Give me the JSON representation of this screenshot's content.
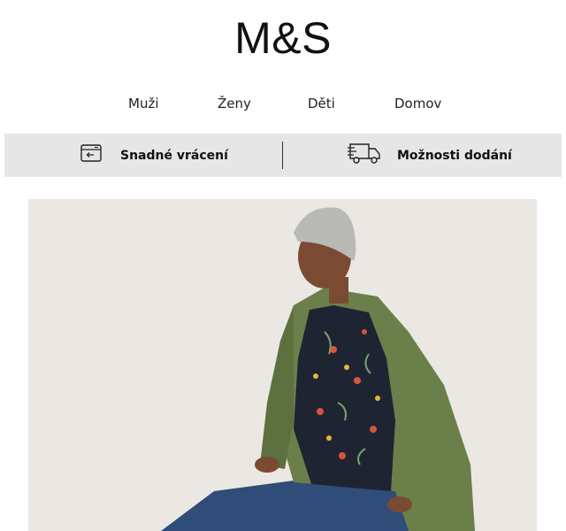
{
  "brand": {
    "logo_text": "M&S"
  },
  "nav": {
    "items": [
      {
        "label": "Muži"
      },
      {
        "label": "Ženy"
      },
      {
        "label": "Děti"
      },
      {
        "label": "Domov"
      }
    ]
  },
  "service_bar": {
    "returns": {
      "label": "Snadné vrácení",
      "icon": "return-box-icon"
    },
    "delivery": {
      "label": "Možnosti dodání",
      "icon": "delivery-truck-icon"
    }
  },
  "hero": {
    "alt": "Model wearing khaki parka, floral blouse, jeans and grey beanie",
    "colors": {
      "background": "#ebe8e3",
      "coat": "#6b7f4a",
      "jeans": "#2f4d78"
    }
  }
}
